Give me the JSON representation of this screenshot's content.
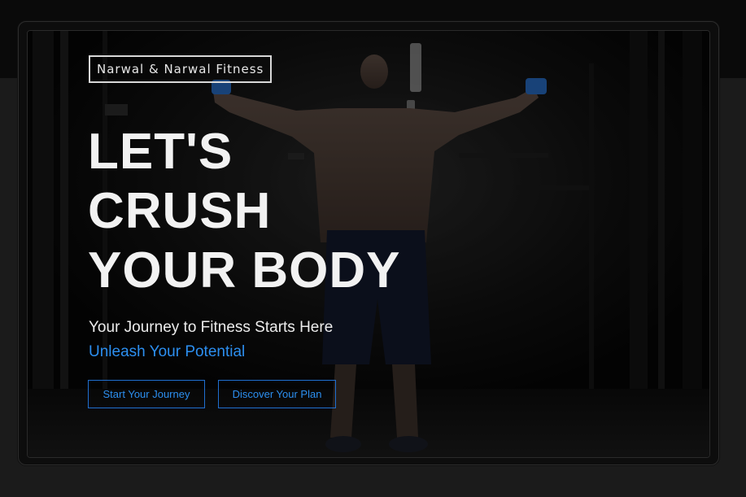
{
  "brand": {
    "name": "Narwal & Narwal Fitness"
  },
  "hero": {
    "headline_lines": [
      "LET'S",
      "CRUSH",
      "YOUR BODY"
    ],
    "subtitle": "Your Journey to Fitness Starts Here",
    "tagline": "Unleash Your Potential",
    "background_image": "dark gym athlete holding cables"
  },
  "actions": {
    "start_label": "Start Your Journey",
    "discover_label": "Discover Your Plan"
  },
  "colors": {
    "accent": "#2c8ff0",
    "page_background": "#1b1b1b",
    "hero_background": "#060606"
  }
}
